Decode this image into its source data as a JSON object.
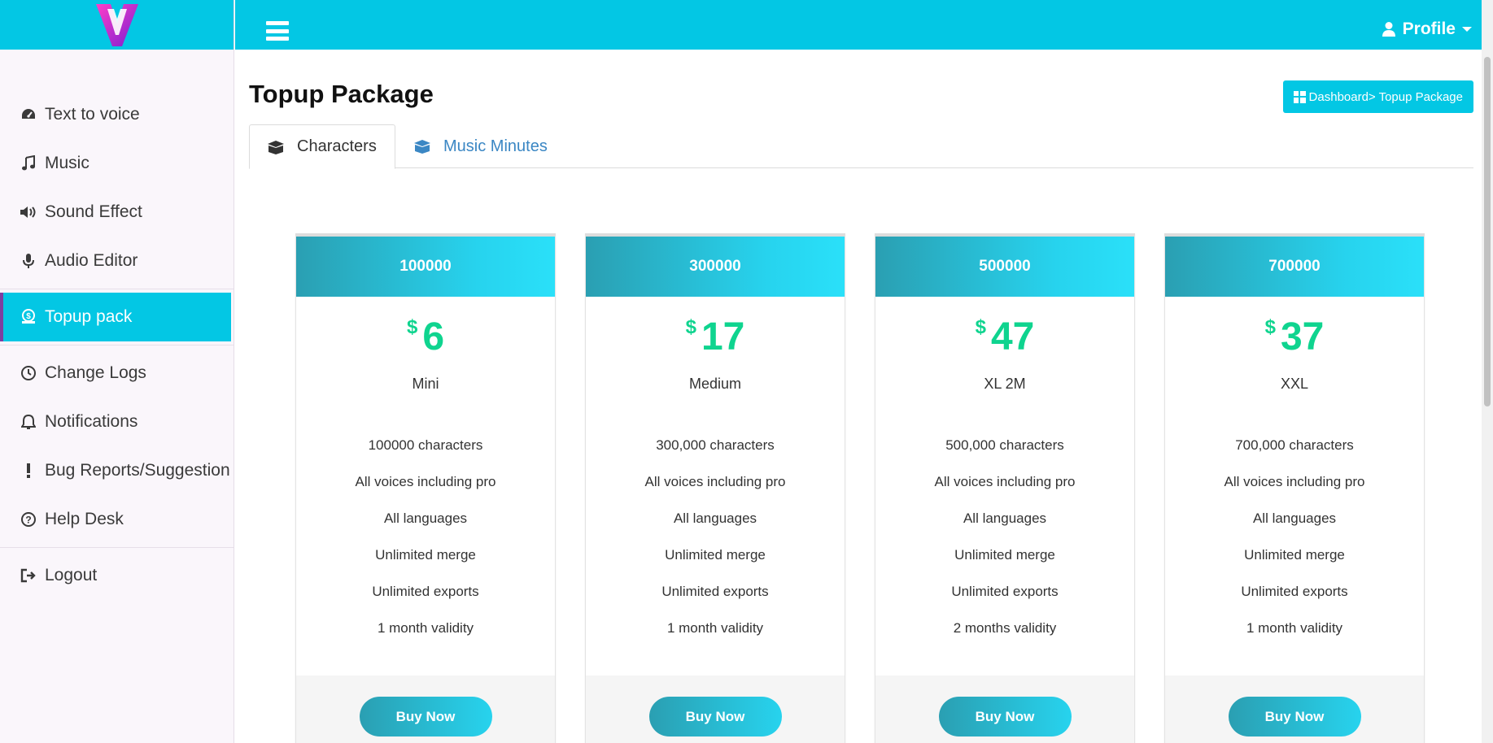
{
  "sidebar": {
    "items": [
      {
        "label": "Text to voice",
        "icon": "gauge-icon"
      },
      {
        "label": "Music",
        "icon": "music-note-icon"
      },
      {
        "label": "Sound Effect",
        "icon": "volume-icon"
      },
      {
        "label": "Audio Editor",
        "icon": "microphone-icon"
      },
      {
        "label": "Topup pack",
        "icon": "money-bag-icon"
      },
      {
        "label": "Change Logs",
        "icon": "clock-icon"
      },
      {
        "label": "Notifications",
        "icon": "bell-icon"
      },
      {
        "label": "Bug Reports/Suggestion",
        "icon": "exclamation-icon"
      },
      {
        "label": "Help Desk",
        "icon": "question-circle-icon"
      },
      {
        "label": "Logout",
        "icon": "sign-out-icon"
      }
    ]
  },
  "topbar": {
    "profile_label": "Profile"
  },
  "page": {
    "title": "Topup Package",
    "breadcrumb": "Dashboard> Topup Package"
  },
  "tabs": [
    {
      "label": "Characters",
      "active": true
    },
    {
      "label": "Music Minutes",
      "active": false
    }
  ],
  "currency_symbol": "$",
  "packages": [
    {
      "header": "100000",
      "price": "6",
      "name": "Mini",
      "features": [
        "100000 characters",
        "All voices including pro",
        "All languages",
        "Unlimited merge",
        "Unlimited exports",
        "1 month validity"
      ],
      "button": "Buy Now"
    },
    {
      "header": "300000",
      "price": "17",
      "name": "Medium",
      "features": [
        "300,000 characters",
        "All voices including pro",
        "All languages",
        "Unlimited merge",
        "Unlimited exports",
        "1 month validity"
      ],
      "button": "Buy Now"
    },
    {
      "header": "500000",
      "price": "47",
      "name": "XL 2M",
      "features": [
        "500,000 characters",
        "All voices including pro",
        "All languages",
        "Unlimited merge",
        "Unlimited exports",
        "2 months validity"
      ],
      "button": "Buy Now"
    },
    {
      "header": "700000",
      "price": "37",
      "name": "XXL",
      "features": [
        "700,000 characters",
        "All voices including pro",
        "All languages",
        "Unlimited merge",
        "Unlimited exports",
        "1 month validity"
      ],
      "button": "Buy Now"
    }
  ],
  "colors": {
    "accent": "#03c7e4",
    "price_green": "#0fd48f",
    "link_blue": "#3b87c4",
    "logo_purple": "#b02fd6"
  }
}
